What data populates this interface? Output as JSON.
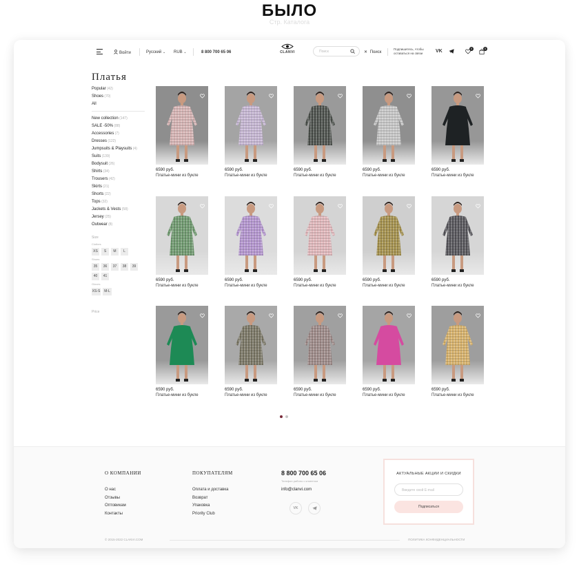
{
  "banner": {
    "title": "БЫЛО",
    "subtitle": "Стр. Каталога"
  },
  "header": {
    "login": "Войти",
    "language": "Русский",
    "currency": "RUB",
    "phone": "8 800 700 65 06",
    "logo": "CLANVI",
    "search_placeholder": "Поиск",
    "search_action": "Поиск",
    "subscribe_line1": "Подпишитесь, чтобы",
    "subscribe_line2": "оставаться на связи",
    "social_vk": "VK",
    "wishlist_count": "0",
    "cart_count": "0"
  },
  "sidebar": {
    "title": "Платья",
    "top_links": [
      {
        "label": "Popular",
        "count": "(42)"
      },
      {
        "label": "Shoes",
        "count": "(70)"
      },
      {
        "label": "All",
        "count": ""
      }
    ],
    "categories": [
      {
        "label": "New collection",
        "count": "(147)"
      },
      {
        "label": "SALE -50%",
        "count": "(88)"
      },
      {
        "label": "Accessories",
        "count": "(7)"
      },
      {
        "label": "Dresses",
        "count": "(122)"
      },
      {
        "label": "Jumpsuits & Playsuits",
        "count": "(4)"
      },
      {
        "label": "Suits",
        "count": "(139)"
      },
      {
        "label": "Bodysuit",
        "count": "(26)"
      },
      {
        "label": "Shirts",
        "count": "(34)"
      },
      {
        "label": "Trousers",
        "count": "(42)"
      },
      {
        "label": "Skirts",
        "count": "(21)"
      },
      {
        "label": "Shorts",
        "count": "(22)"
      },
      {
        "label": "Tops",
        "count": "(32)"
      },
      {
        "label": "Jackets & Vests",
        "count": "(58)"
      },
      {
        "label": "Jersey",
        "count": "(25)"
      },
      {
        "label": "Outwear",
        "count": "(8)"
      }
    ],
    "size_label": "Size",
    "clothes_label": "Clothes",
    "clothes_sizes": [
      "XS",
      "S",
      "M",
      "L"
    ],
    "shoes_label": "Shoes",
    "shoe_sizes": [
      "35",
      "36",
      "37",
      "38",
      "39",
      "40",
      "41"
    ],
    "gloves_label": "Gloves",
    "glove_sizes": [
      "XS-S",
      "M-L"
    ],
    "price_label": "Price"
  },
  "products": [
    {
      "price": "6590 руб.",
      "name": "Платье-мини из букле",
      "dress": "#d9b6b6",
      "bg": "#8e8e8e",
      "pattern": "check"
    },
    {
      "price": "6590 руб.",
      "name": "Платье-мини из букле",
      "dress": "#c8b8d6",
      "bg": "#a4a4a4",
      "pattern": "check"
    },
    {
      "price": "6590 руб.",
      "name": "Платье-мини из букле",
      "dress": "#4a4f4a",
      "bg": "#9a9a9a",
      "pattern": "check"
    },
    {
      "price": "6590 руб.",
      "name": "Платье-мини из букле",
      "dress": "#c9c9c9",
      "bg": "#8f8f8f",
      "pattern": "check"
    },
    {
      "price": "6590 руб.",
      "name": "Платье-мини из букле",
      "dress": "#1e2224",
      "bg": "#979797",
      "pattern": "solid"
    },
    {
      "price": "6590 руб.",
      "name": "Платье-мини из букле",
      "dress": "#6e9a6e",
      "bg": "#d8d8d8",
      "pattern": "check"
    },
    {
      "price": "6590 руб.",
      "name": "Платье-мини из букле",
      "dress": "#b596d2",
      "bg": "#dcdcdc",
      "pattern": "check"
    },
    {
      "price": "6590 руб.",
      "name": "Платье-мини из букле",
      "dress": "#e4b9bd",
      "bg": "#d4d4d4",
      "pattern": "check"
    },
    {
      "price": "6590 руб.",
      "name": "Платье-мини из букле",
      "dress": "#a4904a",
      "bg": "#cfcfcf",
      "pattern": "check"
    },
    {
      "price": "6590 руб.",
      "name": "Платье-мини из букле",
      "dress": "#55545a",
      "bg": "#d6d6d6",
      "pattern": "check"
    },
    {
      "price": "6590 руб.",
      "name": "Платье-мини из букле",
      "dress": "#1d8a55",
      "bg": "#9a9a9a",
      "pattern": "solid"
    },
    {
      "price": "6590 руб.",
      "name": "Платье-мини из букле",
      "dress": "#7a7664",
      "bg": "#a9a9a9",
      "pattern": "check"
    },
    {
      "price": "6590 руб.",
      "name": "Платье-мини из букле",
      "dress": "#9e8a88",
      "bg": "#a0a0a0",
      "pattern": "check"
    },
    {
      "price": "6590 руб.",
      "name": "Платье-мини из букле",
      "dress": "#d54ba0",
      "bg": "#a5a5a5",
      "pattern": "solid"
    },
    {
      "price": "6590 руб.",
      "name": "Платье-мини из букле",
      "dress": "#d9b36a",
      "bg": "#9e9e9e",
      "pattern": "check"
    }
  ],
  "footer": {
    "company_title": "О компании",
    "company_links": [
      "О нас",
      "Отзывы",
      "Оптовикам",
      "Контакты"
    ],
    "customers_title": "Покупателям",
    "customers_links": [
      "Оплата и доставка",
      "Возврат",
      "Упаковка",
      "Priority Club"
    ],
    "phone": "8 800 700 65 06",
    "phone_hint": "Телефон работы с клиентом",
    "email": "info@clanvi.com",
    "social_vk": "VK",
    "promo_title": "АКТУАЛЬНЫЕ АКЦИИ И СКИДКИ",
    "promo_placeholder": "Введите свой E-mail",
    "promo_button": "Подписаться",
    "copyright": "© 2015-2022 CLANVI.COM",
    "privacy": "ПОЛИТИКА КОНФИДЕНЦИАЛЬНОСТИ"
  },
  "pagination": {
    "pages": 2,
    "current": 1
  },
  "colors": {
    "accent": "#7a2b3a",
    "promo_border": "#f6e0dd",
    "promo_button": "#fbe4e1"
  }
}
